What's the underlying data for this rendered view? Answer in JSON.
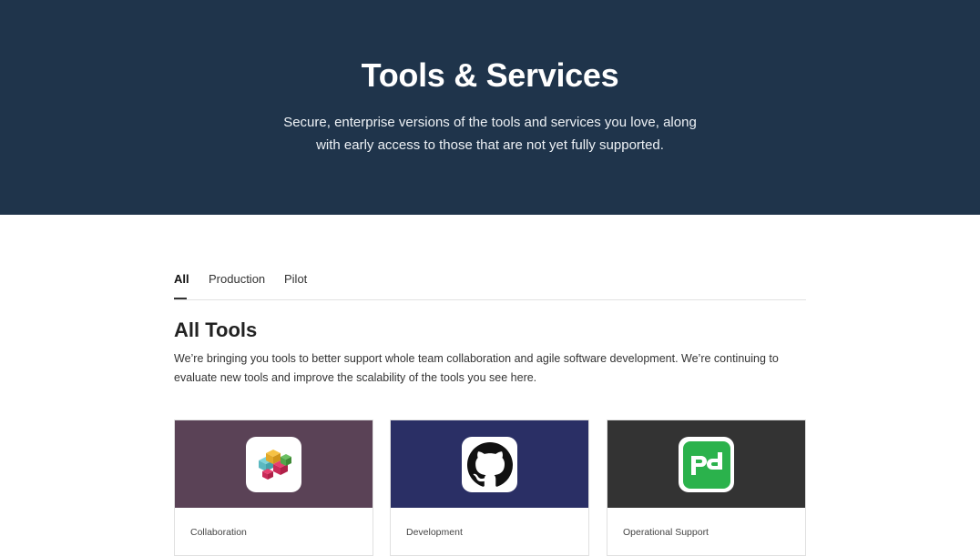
{
  "hero": {
    "title": "Tools & Services",
    "subtitle": "Secure, enterprise versions of the tools and services you love, along with early access to those that are not yet fully supported."
  },
  "tabs": [
    {
      "label": "All",
      "active": true
    },
    {
      "label": "Production",
      "active": false
    },
    {
      "label": "Pilot",
      "active": false
    }
  ],
  "section": {
    "title": "All Tools",
    "description": "We’re bringing you tools to better support whole team collaboration and agile software development. We’re continuing to evaluate new tools and improve the scalability of the tools you see here."
  },
  "cards": [
    {
      "category": "Collaboration",
      "banner_color": "#5a4256",
      "icon": "slack-icon"
    },
    {
      "category": "Development",
      "banner_color": "#2a2f65",
      "icon": "github-icon"
    },
    {
      "category": "Operational Support",
      "banner_color": "#333333",
      "icon": "pagerduty-icon"
    }
  ],
  "colors": {
    "hero_bg": "#1f344b",
    "pagerduty_green": "#2bb24c"
  }
}
